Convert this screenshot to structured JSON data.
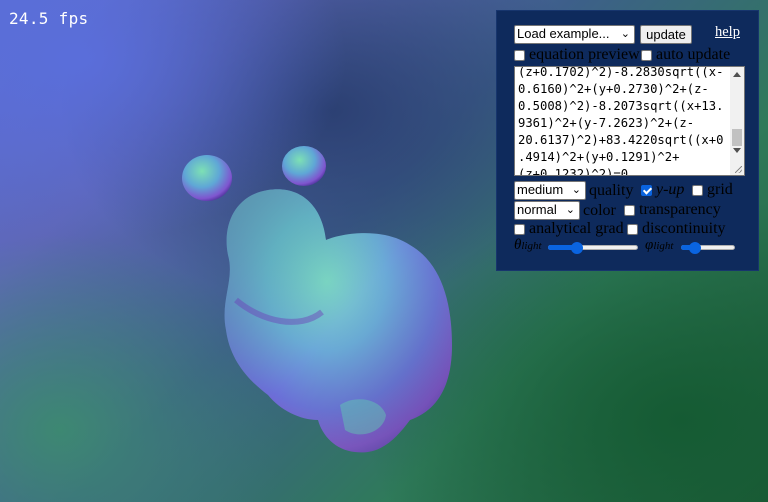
{
  "canvas": {
    "fps": "24.5 fps"
  },
  "panel": {
    "example_select": "Load example...",
    "update_label": "update",
    "help_label": "help",
    "equation_preview": {
      "label": "equation preview",
      "checked": false
    },
    "auto_update": {
      "label": "auto update",
      "checked": false
    },
    "equation_lines": [
      "(z+0.1702)^2)-8.2830sqrt((x-",
      "0.6160)^2+(y+0.2730)^2+(z-",
      "0.5008)^2)-8.2073sqrt((x+13.",
      "9361)^2+(y-7.2623)^2+(z-",
      "20.6137)^2)+83.4220sqrt((x+0",
      ".4914)^2+(y+0.1291)^2+",
      "(z+0.1232)^2)=0"
    ],
    "quality_select": "medium",
    "quality_label": "quality",
    "y_up": {
      "label": "y-up",
      "checked": true
    },
    "grid": {
      "label": "grid",
      "checked": false
    },
    "color_select": "normal",
    "color_label": "color",
    "transparency": {
      "label": "transparency",
      "checked": false
    },
    "analytical_grad": {
      "label": "analytical grad",
      "checked": false
    },
    "discontinuity": {
      "label": "discontinuity",
      "checked": false
    },
    "theta_light": {
      "symbol": "θ",
      "sub": "light",
      "value": 0.3
    },
    "phi_light": {
      "symbol": "φ",
      "sub": "light",
      "value": 0.2
    }
  }
}
